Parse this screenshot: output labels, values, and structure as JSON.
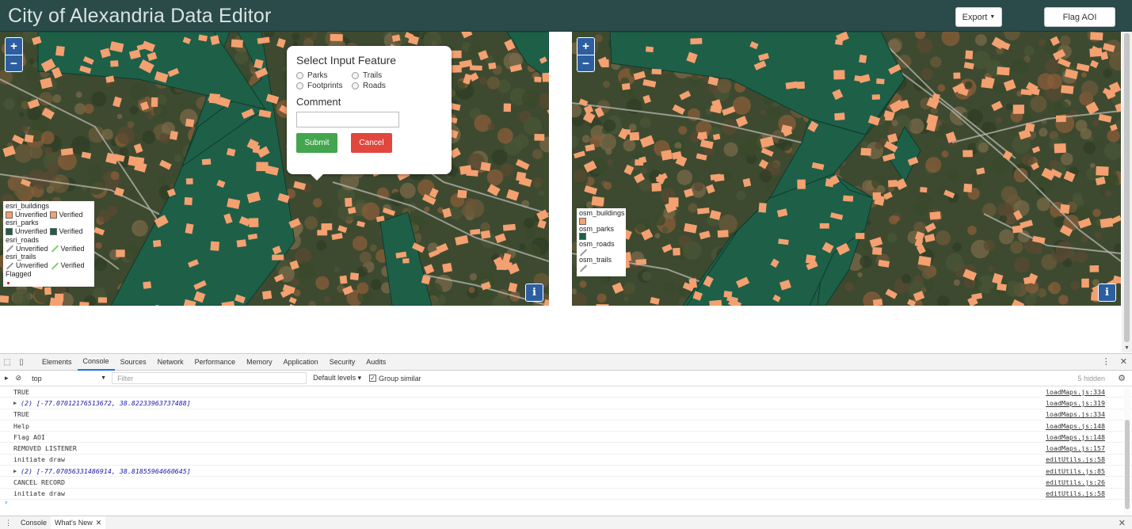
{
  "header": {
    "title": "City of Alexandria Data Editor",
    "export_label": "Export",
    "flag_label": "Flag AOI"
  },
  "colors": {
    "header_bg": "#2b4a4a",
    "building": "#f4a070",
    "park": "#1e5f48",
    "submit": "#44a54f",
    "cancel": "#e1473d",
    "map_button": "#2d5fa0"
  },
  "map_controls": {
    "zoom_in": "+",
    "zoom_out": "−",
    "info": "i"
  },
  "left_legend": {
    "groups": [
      {
        "title": "esri_buildings",
        "unverified": "Unverified",
        "verified": "Verified",
        "icon": "building-swatch"
      },
      {
        "title": "esri_parks",
        "unverified": "Unverified",
        "verified": "Verified",
        "icon": "park-swatch"
      },
      {
        "title": "esri_roads",
        "unverified": "Unverified",
        "verified": "Verified",
        "icon": "line-swatch"
      },
      {
        "title": "esri_trails",
        "unverified": "Unverified",
        "verified": "Verified",
        "icon": "line-swatch"
      }
    ],
    "flagged_label": "Flagged"
  },
  "right_legend": {
    "items": [
      "osm_buildings",
      "osm_parks",
      "osm_roads",
      "osm_trails"
    ]
  },
  "popup": {
    "title": "Select Input Feature",
    "options": [
      "Parks",
      "Trails",
      "Footprints",
      "Roads"
    ],
    "comment_label": "Comment",
    "comment_value": "",
    "submit_label": "Submit",
    "cancel_label": "Cancel"
  },
  "devtools": {
    "tabs": [
      "Elements",
      "Console",
      "Sources",
      "Network",
      "Performance",
      "Memory",
      "Application",
      "Security",
      "Audits"
    ],
    "active_tab": "Console",
    "context": "top",
    "filter_placeholder": "Filter",
    "levels": "Default levels ▾",
    "group_similar": "Group similar",
    "hidden_count": "5 hidden",
    "logs": [
      {
        "text": "TRUE",
        "source": "loadMaps.js:334",
        "expandable": false
      },
      {
        "text": "(2) [-77.07012176513672, 38.82233963737488]",
        "source": "loadMaps.js:319",
        "expandable": true
      },
      {
        "text": "TRUE",
        "source": "loadMaps.js:334",
        "expandable": false
      },
      {
        "text": "Help",
        "source": "loadMaps.js:148",
        "expandable": false
      },
      {
        "text": "Flag AOI",
        "source": "loadMaps.js:148",
        "expandable": false
      },
      {
        "text": "REMOVED LISTENER",
        "source": "loadMaps.js:157",
        "expandable": false
      },
      {
        "text": "initiate draw",
        "source": "editUtils.js:58",
        "expandable": false
      },
      {
        "text": "(2) [-77.07056331486914, 38.81855964660645]",
        "source": "editUtils.js:85",
        "expandable": true
      },
      {
        "text": "CANCEL RECORD",
        "source": "editUtils.js:26",
        "expandable": false
      },
      {
        "text": "initiate draw",
        "source": "editUtils.js:58",
        "expandable": false
      }
    ],
    "prompt": "›",
    "drawer_tabs": [
      "Console",
      "What's New"
    ]
  }
}
